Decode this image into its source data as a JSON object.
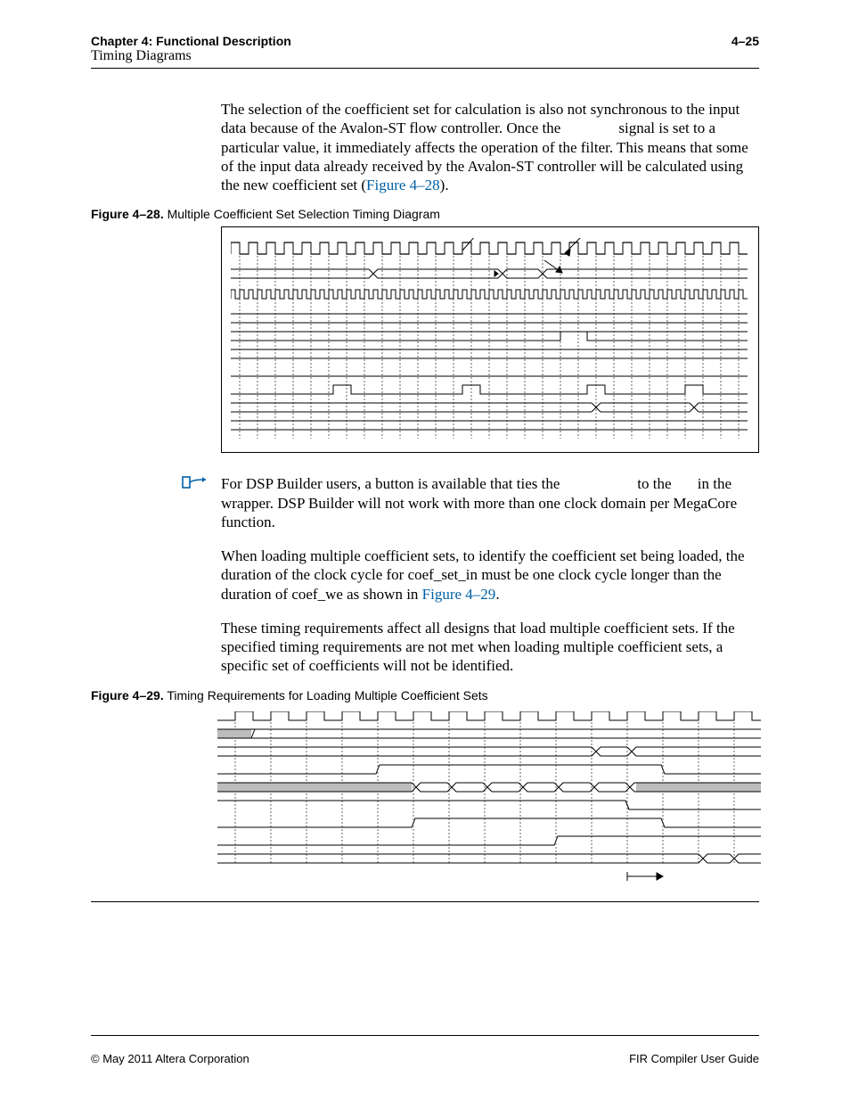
{
  "header": {
    "chapter": "Chapter 4: Functional Description",
    "section": "Timing Diagrams",
    "pageNum": "4–25"
  },
  "p1a": "The selection of the coefficient set for calculation is also not synchronous to the input data because of the Avalon-ST flow controller. Once the ",
  "p1b": " signal is set to a particular value, it immediately affects the operation of the filter. This means that some of the input data already received by the Avalon-ST controller will be calculated using the new coefficient set (",
  "p1link": "Figure 4–28",
  "p1c": ").",
  "fig28": {
    "num": "Figure 4–28.",
    "title": "Multiple Coefficient Set Selection Timing Diagram"
  },
  "noteA": "For DSP Builder users, a button is available that ties the ",
  "noteB": " to the ",
  "noteC": " in the wrapper. DSP Builder will not work with more than one clock domain per MegaCore function.",
  "p2a": "When loading multiple coefficient sets, to identify the coefficient set being loaded, the duration of the clock cycle for coef_set_in must be one clock cycle longer than the duration of coef_we as shown in ",
  "p2link": "Figure 4–29",
  "p2b": ".",
  "p3": "These timing requirements affect all designs that load multiple coefficient sets. If the specified timing requirements are not met when loading multiple coefficient sets, a specific set of coefficients will not be identified.",
  "fig29": {
    "num": "Figure 4–29.",
    "title": "Timing Requirements for Loading Multiple Coefficient Sets"
  },
  "footerLeft": "© May 2011   Altera Corporation",
  "footerRight": "FIR Compiler User Guide"
}
